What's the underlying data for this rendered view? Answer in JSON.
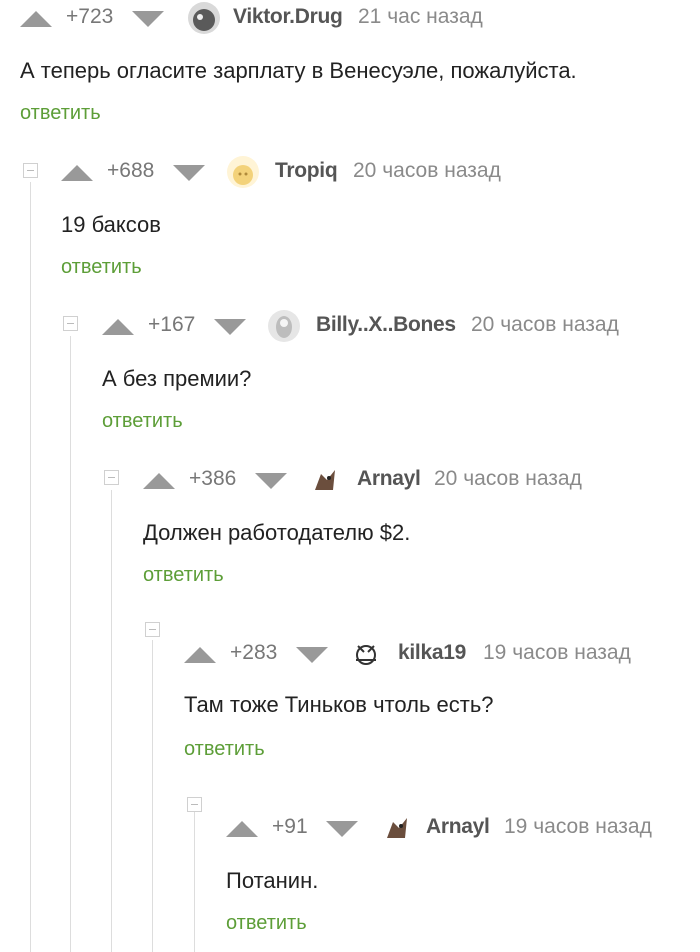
{
  "comments": [
    {
      "rating": "+723",
      "author": "Viktor.Drug",
      "time": "21 час назад",
      "text": "А теперь огласите зарплату в Венесуэле, пожалуйста.",
      "reply": "ответить",
      "avatar": "viktor-avatar",
      "avatar_color": "#6b6b6b"
    },
    {
      "rating": "+688",
      "author": "Tropiq",
      "time": "20 часов назад",
      "text": "19 баксов",
      "reply": "ответить",
      "avatar": "tropiq-avatar",
      "avatar_color": "#f3d27a"
    },
    {
      "rating": "+167",
      "author": "Billy..X..Bones",
      "time": "20 часов назад",
      "text": "А без премии?",
      "reply": "ответить",
      "avatar": "billy-avatar",
      "avatar_color": "#cfcfcf"
    },
    {
      "rating": "+386",
      "author": "Arnayl",
      "time": "20 часов назад",
      "text": "Должен работодателю $2.",
      "reply": "ответить",
      "avatar": "arnayl-avatar",
      "avatar_color": "#7a5a4a"
    },
    {
      "rating": "+283",
      "author": "kilka19",
      "time": "19 часов назад",
      "text": "Там тоже Тиньков чтоль есть?",
      "reply": "ответить",
      "avatar": "kilka-avatar",
      "avatar_color": "#ffffff"
    },
    {
      "rating": "+91",
      "author": "Arnayl",
      "time": "19 часов назад",
      "text": "Потанин.",
      "reply": "ответить",
      "avatar": "arnayl-avatar",
      "avatar_color": "#7a5a4a"
    }
  ],
  "colors": {
    "reply": "#5d9e38",
    "arrow": "#999999",
    "thread_line": "#dddddd"
  }
}
